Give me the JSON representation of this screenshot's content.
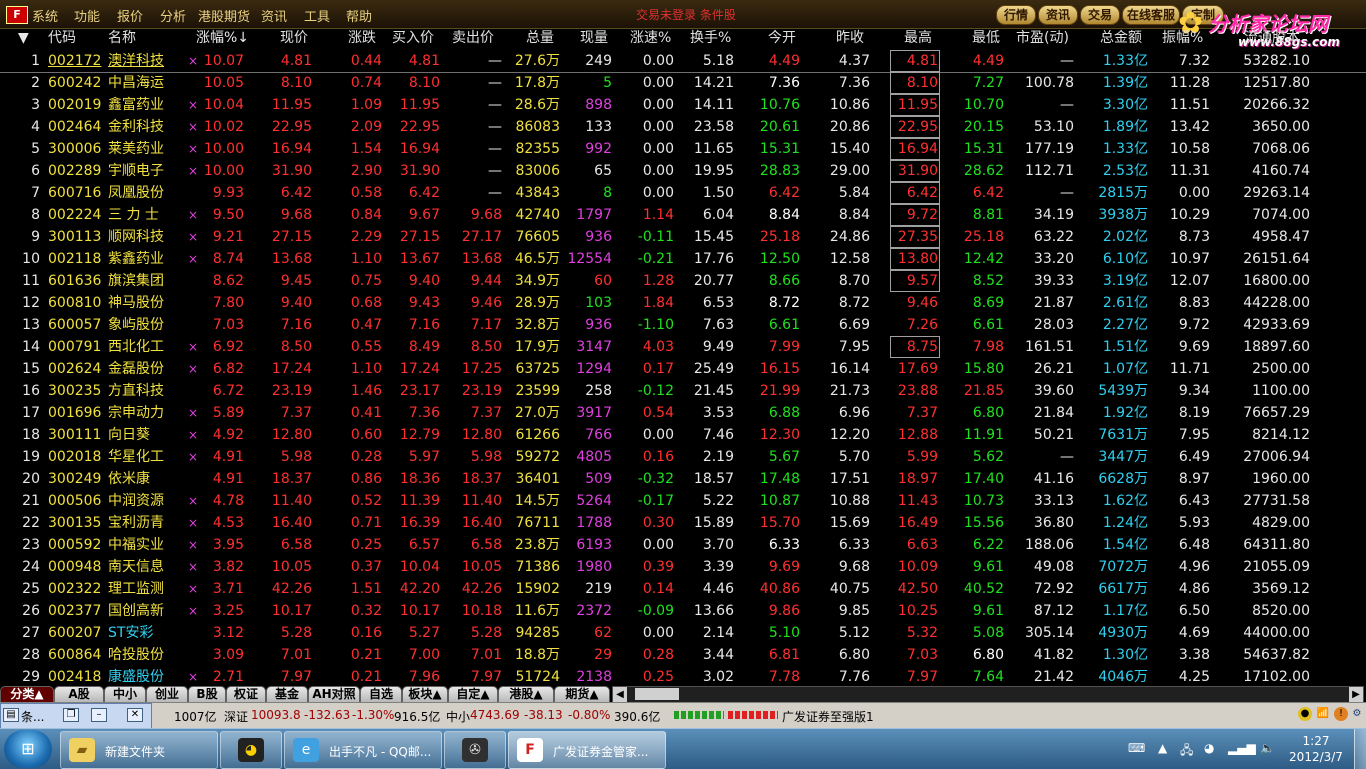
{
  "menu": [
    "系统",
    "功能",
    "报价",
    "分析",
    "港股期货",
    "资讯",
    "工具",
    "帮助"
  ],
  "login_status": "交易未登录  条件股",
  "top_buttons": [
    "行情",
    "资讯",
    "交易",
    "在线客服",
    "定制"
  ],
  "brand": {
    "main": "分析家论坛网",
    "url": "www.88gs.com"
  },
  "columns": [
    "代码",
    "名称",
    "涨幅%↓",
    "现价",
    "涨跌",
    "买入价",
    "卖出价",
    "总量",
    "现量",
    "涨速%",
    "换手%",
    "今开",
    "昨收",
    "最高",
    "最低",
    "市盈(动)",
    "总金额",
    "振幅%",
    "流通股本"
  ],
  "rows": [
    {
      "n": "1",
      "code": "002172",
      "name": "澳洋科技",
      "flag": "×",
      "chg": "10.07",
      "price": "4.81",
      "diff": "0.44",
      "bid": "4.81",
      "ask": "—",
      "vol": "27.6万",
      "cur": "249",
      "curc": "w",
      "spd": "0.00",
      "turn": "5.18",
      "open": "4.49",
      "openc": "r",
      "prev": "4.37",
      "high": "4.81",
      "low": "4.49",
      "lowc": "r",
      "pe": "7.32",
      "amt": "1.33亿",
      "amp": "7.32",
      "float": "53282.10",
      "pev": "—"
    },
    {
      "n": "2",
      "code": "600242",
      "name": "中昌海运",
      "flag": "",
      "chg": "10.05",
      "price": "8.10",
      "diff": "0.74",
      "bid": "8.10",
      "ask": "—",
      "vol": "17.8万",
      "cur": "5",
      "curc": "g",
      "spd": "0.00",
      "turn": "14.21",
      "open": "7.36",
      "openc": "w",
      "prev": "7.36",
      "high": "8.10",
      "low": "7.27",
      "lowc": "g",
      "pev": "100.78",
      "amt": "1.39亿",
      "amp": "11.28",
      "float": "12517.80"
    },
    {
      "n": "3",
      "code": "002019",
      "name": "鑫富药业",
      "flag": "×",
      "chg": "10.04",
      "price": "11.95",
      "diff": "1.09",
      "bid": "11.95",
      "ask": "—",
      "vol": "28.6万",
      "cur": "898",
      "curc": "m",
      "spd": "0.00",
      "turn": "14.11",
      "open": "10.76",
      "openc": "g",
      "prev": "10.86",
      "high": "11.95",
      "low": "10.70",
      "lowc": "g",
      "pev": "—",
      "amt": "3.30亿",
      "amp": "11.51",
      "float": "20266.32"
    },
    {
      "n": "4",
      "code": "002464",
      "name": "金利科技",
      "flag": "×",
      "chg": "10.02",
      "price": "22.95",
      "diff": "2.09",
      "bid": "22.95",
      "ask": "—",
      "vol": "86083",
      "cur": "133",
      "curc": "w",
      "spd": "0.00",
      "turn": "23.58",
      "open": "20.61",
      "openc": "g",
      "prev": "20.86",
      "high": "22.95",
      "low": "20.15",
      "lowc": "g",
      "pev": "53.10",
      "amt": "1.89亿",
      "amp": "13.42",
      "float": "3650.00"
    },
    {
      "n": "5",
      "code": "300006",
      "name": "莱美药业",
      "flag": "×",
      "chg": "10.00",
      "price": "16.94",
      "diff": "1.54",
      "bid": "16.94",
      "ask": "—",
      "vol": "82355",
      "cur": "992",
      "curc": "m",
      "spd": "0.00",
      "turn": "11.65",
      "open": "15.31",
      "openc": "g",
      "prev": "15.40",
      "high": "16.94",
      "low": "15.31",
      "lowc": "g",
      "pev": "177.19",
      "amt": "1.33亿",
      "amp": "10.58",
      "float": "7068.06"
    },
    {
      "n": "6",
      "code": "002289",
      "name": "宇顺电子",
      "flag": "×",
      "chg": "10.00",
      "price": "31.90",
      "diff": "2.90",
      "bid": "31.90",
      "ask": "—",
      "vol": "83006",
      "cur": "65",
      "curc": "w",
      "spd": "0.00",
      "turn": "19.95",
      "open": "28.83",
      "openc": "g",
      "prev": "29.00",
      "high": "31.90",
      "low": "28.62",
      "lowc": "g",
      "pev": "112.71",
      "amt": "2.53亿",
      "amp": "11.31",
      "float": "4160.74"
    },
    {
      "n": "7",
      "code": "600716",
      "name": "凤凰股份",
      "flag": "",
      "chg": "9.93",
      "price": "6.42",
      "diff": "0.58",
      "bid": "6.42",
      "ask": "—",
      "vol": "43843",
      "cur": "8",
      "curc": "g",
      "spd": "0.00",
      "turn": "1.50",
      "open": "6.42",
      "openc": "r",
      "prev": "5.84",
      "high": "6.42",
      "low": "6.42",
      "lowc": "r",
      "pev": "—",
      "amt": "2815万",
      "amp": "0.00",
      "float": "29263.14"
    },
    {
      "n": "8",
      "code": "002224",
      "name": "三 力 士",
      "flag": "×",
      "chg": "9.50",
      "price": "9.68",
      "diff": "0.84",
      "bid": "9.67",
      "ask": "9.68",
      "vol": "42740",
      "cur": "1797",
      "curc": "m",
      "spd": "1.14",
      "turn": "6.04",
      "open": "8.84",
      "openc": "w",
      "prev": "8.84",
      "high": "9.72",
      "low": "8.81",
      "lowc": "g",
      "pev": "34.19",
      "amt": "3938万",
      "amp": "10.29",
      "float": "7074.00"
    },
    {
      "n": "9",
      "code": "300113",
      "name": "顺网科技",
      "flag": "×",
      "chg": "9.21",
      "price": "27.15",
      "diff": "2.29",
      "bid": "27.15",
      "ask": "27.17",
      "vol": "76605",
      "cur": "936",
      "curc": "m",
      "spd": "-0.11",
      "turn": "15.45",
      "open": "25.18",
      "openc": "r",
      "prev": "24.86",
      "high": "27.35",
      "low": "25.18",
      "lowc": "r",
      "pev": "63.22",
      "amt": "2.02亿",
      "amp": "8.73",
      "float": "4958.47"
    },
    {
      "n": "10",
      "code": "002118",
      "name": "紫鑫药业",
      "flag": "×",
      "chg": "8.74",
      "price": "13.68",
      "diff": "1.10",
      "bid": "13.67",
      "ask": "13.68",
      "vol": "46.5万",
      "cur": "12554",
      "curc": "m",
      "spd": "-0.21",
      "turn": "17.76",
      "open": "12.50",
      "openc": "g",
      "prev": "12.58",
      "high": "13.80",
      "low": "12.42",
      "lowc": "g",
      "pev": "33.20",
      "amt": "6.10亿",
      "amp": "10.97",
      "float": "26151.64"
    },
    {
      "n": "11",
      "code": "601636",
      "name": "旗滨集团",
      "flag": "",
      "chg": "8.62",
      "price": "9.45",
      "diff": "0.75",
      "bid": "9.40",
      "ask": "9.44",
      "vol": "34.9万",
      "cur": "60",
      "curc": "r",
      "spd": "1.28",
      "turn": "20.77",
      "open": "8.66",
      "openc": "g",
      "prev": "8.70",
      "high": "9.57",
      "low": "8.52",
      "lowc": "g",
      "pev": "39.33",
      "amt": "3.19亿",
      "amp": "12.07",
      "float": "16800.00"
    },
    {
      "n": "12",
      "code": "600810",
      "name": "神马股份",
      "flag": "",
      "chg": "7.80",
      "price": "9.40",
      "diff": "0.68",
      "bid": "9.43",
      "ask": "9.46",
      "vol": "28.9万",
      "cur": "103",
      "curc": "g",
      "spd": "1.84",
      "turn": "6.53",
      "open": "8.72",
      "openc": "w",
      "prev": "8.72",
      "high": "9.46",
      "low": "8.69",
      "lowc": "g",
      "pev": "21.87",
      "amt": "2.61亿",
      "amp": "8.83",
      "float": "44228.00"
    },
    {
      "n": "13",
      "code": "600057",
      "name": "象屿股份",
      "flag": "",
      "chg": "7.03",
      "price": "7.16",
      "diff": "0.47",
      "bid": "7.16",
      "ask": "7.17",
      "vol": "32.8万",
      "cur": "936",
      "curc": "m",
      "spd": "-1.10",
      "turn": "7.63",
      "open": "6.61",
      "openc": "g",
      "prev": "6.69",
      "high": "7.26",
      "low": "6.61",
      "lowc": "g",
      "pev": "28.03",
      "amt": "2.27亿",
      "amp": "9.72",
      "float": "42933.69"
    },
    {
      "n": "14",
      "code": "000791",
      "name": "西北化工",
      "flag": "×",
      "chg": "6.92",
      "price": "8.50",
      "diff": "0.55",
      "bid": "8.49",
      "ask": "8.50",
      "vol": "17.9万",
      "cur": "3147",
      "curc": "m",
      "spd": "4.03",
      "turn": "9.49",
      "open": "7.99",
      "openc": "r",
      "prev": "7.95",
      "high": "8.75",
      "low": "7.98",
      "lowc": "r",
      "pev": "161.51",
      "amt": "1.51亿",
      "amp": "9.69",
      "float": "18897.60"
    },
    {
      "n": "15",
      "code": "002624",
      "name": "金磊股份",
      "flag": "×",
      "chg": "6.82",
      "price": "17.24",
      "diff": "1.10",
      "bid": "17.24",
      "ask": "17.25",
      "vol": "63725",
      "cur": "1294",
      "curc": "m",
      "spd": "0.17",
      "turn": "25.49",
      "open": "16.15",
      "openc": "r",
      "prev": "16.14",
      "high": "17.69",
      "low": "15.80",
      "lowc": "g",
      "pev": "26.21",
      "amt": "1.07亿",
      "amp": "11.71",
      "float": "2500.00"
    },
    {
      "n": "16",
      "code": "300235",
      "name": "方直科技",
      "flag": "",
      "chg": "6.72",
      "price": "23.19",
      "diff": "1.46",
      "bid": "23.17",
      "ask": "23.19",
      "vol": "23599",
      "cur": "258",
      "curc": "w",
      "spd": "-0.12",
      "turn": "21.45",
      "open": "21.99",
      "openc": "r",
      "prev": "21.73",
      "high": "23.88",
      "low": "21.85",
      "lowc": "r",
      "pev": "39.60",
      "amt": "5439万",
      "amp": "9.34",
      "float": "1100.00"
    },
    {
      "n": "17",
      "code": "001696",
      "name": "宗申动力",
      "flag": "×",
      "chg": "5.89",
      "price": "7.37",
      "diff": "0.41",
      "bid": "7.36",
      "ask": "7.37",
      "vol": "27.0万",
      "cur": "3917",
      "curc": "m",
      "spd": "0.54",
      "turn": "3.53",
      "open": "6.88",
      "openc": "g",
      "prev": "6.96",
      "high": "7.37",
      "low": "6.80",
      "lowc": "g",
      "pev": "21.84",
      "amt": "1.92亿",
      "amp": "8.19",
      "float": "76657.29"
    },
    {
      "n": "18",
      "code": "300111",
      "name": "向日葵",
      "flag": "×",
      "chg": "4.92",
      "price": "12.80",
      "diff": "0.60",
      "bid": "12.79",
      "ask": "12.80",
      "vol": "61266",
      "cur": "766",
      "curc": "m",
      "spd": "0.00",
      "turn": "7.46",
      "open": "12.30",
      "openc": "r",
      "prev": "12.20",
      "high": "12.88",
      "low": "11.91",
      "lowc": "g",
      "pev": "50.21",
      "amt": "7631万",
      "amp": "7.95",
      "float": "8214.12"
    },
    {
      "n": "19",
      "code": "002018",
      "name": "华星化工",
      "flag": "×",
      "chg": "4.91",
      "price": "5.98",
      "diff": "0.28",
      "bid": "5.97",
      "ask": "5.98",
      "vol": "59272",
      "cur": "4805",
      "curc": "m",
      "spd": "0.16",
      "turn": "2.19",
      "open": "5.67",
      "openc": "g",
      "prev": "5.70",
      "high": "5.99",
      "low": "5.62",
      "lowc": "g",
      "pev": "—",
      "amt": "3447万",
      "amp": "6.49",
      "float": "27006.94"
    },
    {
      "n": "20",
      "code": "300249",
      "name": "依米康",
      "flag": "",
      "chg": "4.91",
      "price": "18.37",
      "diff": "0.86",
      "bid": "18.36",
      "ask": "18.37",
      "vol": "36401",
      "cur": "509",
      "curc": "m",
      "spd": "-0.32",
      "turn": "18.57",
      "open": "17.48",
      "openc": "g",
      "prev": "17.51",
      "high": "18.97",
      "low": "17.40",
      "lowc": "g",
      "pev": "41.16",
      "amt": "6628万",
      "amp": "8.97",
      "float": "1960.00"
    },
    {
      "n": "21",
      "code": "000506",
      "name": "中润资源",
      "flag": "×",
      "chg": "4.78",
      "price": "11.40",
      "diff": "0.52",
      "bid": "11.39",
      "ask": "11.40",
      "vol": "14.5万",
      "cur": "5264",
      "curc": "m",
      "spd": "-0.17",
      "turn": "5.22",
      "open": "10.87",
      "openc": "g",
      "prev": "10.88",
      "high": "11.43",
      "low": "10.73",
      "lowc": "g",
      "pev": "33.13",
      "amt": "1.62亿",
      "amp": "6.43",
      "float": "27731.58"
    },
    {
      "n": "22",
      "code": "300135",
      "name": "宝利沥青",
      "flag": "×",
      "chg": "4.53",
      "price": "16.40",
      "diff": "0.71",
      "bid": "16.39",
      "ask": "16.40",
      "vol": "76711",
      "cur": "1788",
      "curc": "m",
      "spd": "0.30",
      "turn": "15.89",
      "open": "15.70",
      "openc": "r",
      "prev": "15.69",
      "high": "16.49",
      "low": "15.56",
      "lowc": "g",
      "pev": "36.80",
      "amt": "1.24亿",
      "amp": "5.93",
      "float": "4829.00"
    },
    {
      "n": "23",
      "code": "000592",
      "name": "中福实业",
      "flag": "×",
      "chg": "3.95",
      "price": "6.58",
      "diff": "0.25",
      "bid": "6.57",
      "ask": "6.58",
      "vol": "23.8万",
      "cur": "6193",
      "curc": "m",
      "spd": "0.00",
      "turn": "3.70",
      "open": "6.33",
      "openc": "w",
      "prev": "6.33",
      "high": "6.63",
      "low": "6.22",
      "lowc": "g",
      "pev": "188.06",
      "amt": "1.54亿",
      "amp": "6.48",
      "float": "64311.80"
    },
    {
      "n": "24",
      "code": "000948",
      "name": "南天信息",
      "flag": "×",
      "chg": "3.82",
      "price": "10.05",
      "diff": "0.37",
      "bid": "10.04",
      "ask": "10.05",
      "vol": "71386",
      "cur": "1980",
      "curc": "m",
      "spd": "0.39",
      "turn": "3.39",
      "open": "9.69",
      "openc": "r",
      "prev": "9.68",
      "high": "10.09",
      "low": "9.61",
      "lowc": "g",
      "pev": "49.08",
      "amt": "7072万",
      "amp": "4.96",
      "float": "21055.09"
    },
    {
      "n": "25",
      "code": "002322",
      "name": "理工监测",
      "flag": "×",
      "chg": "3.71",
      "price": "42.26",
      "diff": "1.51",
      "bid": "42.20",
      "ask": "42.26",
      "vol": "15902",
      "cur": "219",
      "curc": "w",
      "spd": "0.14",
      "turn": "4.46",
      "open": "40.86",
      "openc": "r",
      "prev": "40.75",
      "high": "42.50",
      "low": "40.52",
      "lowc": "g",
      "pev": "72.92",
      "amt": "6617万",
      "amp": "4.86",
      "float": "3569.12"
    },
    {
      "n": "26",
      "code": "002377",
      "name": "国创高新",
      "flag": "×",
      "chg": "3.25",
      "price": "10.17",
      "diff": "0.32",
      "bid": "10.17",
      "ask": "10.18",
      "vol": "11.6万",
      "cur": "2372",
      "curc": "m",
      "spd": "-0.09",
      "turn": "13.66",
      "open": "9.86",
      "openc": "r",
      "prev": "9.85",
      "high": "10.25",
      "low": "9.61",
      "lowc": "g",
      "pev": "87.12",
      "amt": "1.17亿",
      "amp": "6.50",
      "float": "8520.00"
    },
    {
      "n": "27",
      "code": "600207",
      "name": "ST安彩",
      "flag": "",
      "chg": "3.12",
      "price": "5.28",
      "diff": "0.16",
      "bid": "5.27",
      "ask": "5.28",
      "vol": "94285",
      "cur": "62",
      "curc": "r",
      "spd": "0.00",
      "turn": "2.14",
      "open": "5.10",
      "openc": "g",
      "prev": "5.12",
      "high": "5.32",
      "low": "5.08",
      "lowc": "g",
      "pev": "305.14",
      "amt": "4930万",
      "amp": "4.69",
      "float": "44000.00"
    },
    {
      "n": "28",
      "code": "600864",
      "name": "哈投股份",
      "flag": "",
      "chg": "3.09",
      "price": "7.01",
      "diff": "0.21",
      "bid": "7.00",
      "ask": "7.01",
      "vol": "18.8万",
      "cur": "29",
      "curc": "r",
      "spd": "0.28",
      "turn": "3.44",
      "open": "6.81",
      "openc": "r",
      "prev": "6.80",
      "high": "7.03",
      "low": "6.80",
      "lowc": "w",
      "pev": "41.82",
      "amt": "1.30亿",
      "amp": "3.38",
      "float": "54637.82"
    },
    {
      "n": "29",
      "code": "002418",
      "name": "康盛股份",
      "flag": "×",
      "chg": "2.71",
      "price": "7.97",
      "diff": "0.21",
      "bid": "7.96",
      "ask": "7.97",
      "vol": "51724",
      "cur": "2138",
      "curc": "m",
      "spd": "0.25",
      "turn": "3.02",
      "open": "7.78",
      "openc": "r",
      "prev": "7.76",
      "high": "7.97",
      "low": "7.64",
      "lowc": "g",
      "pev": "21.42",
      "amt": "4046万",
      "amp": "4.25",
      "float": "17102.00"
    }
  ],
  "tabs": [
    "分类▲",
    "A股",
    "中小",
    "创业",
    "B股",
    "权证",
    "基金",
    "AH对照",
    "自选",
    "板块▲",
    "自定▲",
    "港股▲",
    "期货▲"
  ],
  "status": {
    "mini_title": "条...",
    "sh_amount": "1007亿",
    "sz_label": "深证",
    "sz_index": "10093.8",
    "sz_diff": "-132.63",
    "sz_pct": "-1.30%",
    "sz_amount": "916.5亿",
    "zx_label": "中小",
    "zx_index": "4743.69",
    "zx_diff": "-38.13",
    "zx_pct": "-0.80%",
    "zx_amount": "390.6亿",
    "broker": "广发证券至强版1"
  },
  "taskbar": {
    "tasks": [
      "新建文件夹",
      "出手不凡 - QQ邮...",
      "广发证券金管家..."
    ],
    "time": "1:27",
    "date": "2012/3/7"
  },
  "colors": {
    "up": "#ff3030",
    "down": "#20e020",
    "neutral": "#e8e8e8",
    "yellow": "#f0e040",
    "cyan": "#30d0f0",
    "magenta": "#e040e0"
  }
}
